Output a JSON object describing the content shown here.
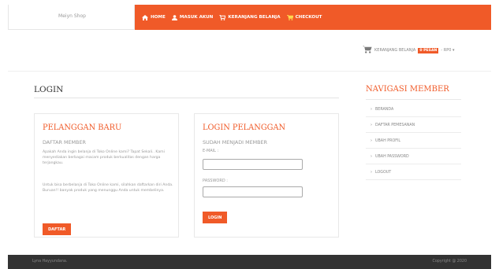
{
  "header": {
    "brand": "Meiyn Shop",
    "nav": [
      {
        "label": "HOME",
        "icon": "home-icon"
      },
      {
        "label": "MASUK AKUN",
        "icon": "user-icon"
      },
      {
        "label": "KERANJANG BELANJA",
        "icon": "cart-icon"
      },
      {
        "label": "CHECKOUT",
        "icon": "checkout-cart-icon"
      }
    ]
  },
  "cart": {
    "label": "KERANJANG BELANJA",
    "badge": "0 PESAN",
    "amount": "- RP0 ▾"
  },
  "login": {
    "title": "LOGIN",
    "new_customer": {
      "title": "PELANGGAN BARU",
      "subtitle": "DAFTAR MEMBER",
      "para1": "Apakah Anda ingin belanja di Toko Online kami? Tapat Sekali.. Kami menyediakan berbagai macam produk berkualitas dengan harga terjangkau.",
      "para2": "Untuk bisa berbelanja di Toko Online kami, silahkan daftarkan diri Anda. Buruan!! banyak produk yang menunggu Anda untuk membelinya.",
      "button": "DAFTAR"
    },
    "customer_login": {
      "title": "LOGIN PELANGGAN",
      "subtitle": "SUDAH MENJADI MEMBER",
      "email_label": "E-MAIL :",
      "email_value": "",
      "password_label": "PASSWORD :",
      "password_value": "",
      "button": "LOGIN"
    }
  },
  "sidebar": {
    "title": "NAVIGASI MEMBER",
    "items": [
      {
        "label": "BERANDA"
      },
      {
        "label": "DAFTAR PEMESANAN"
      },
      {
        "label": "UBAH PROFIL"
      },
      {
        "label": "UBAH PASSWORD"
      },
      {
        "label": "LOGOUT"
      }
    ]
  },
  "footer": {
    "left": "Lyna Hayyundana.",
    "right": "Copyright @ 2020"
  },
  "colors": {
    "accent": "#f05a28",
    "footer_bg": "#333333"
  }
}
